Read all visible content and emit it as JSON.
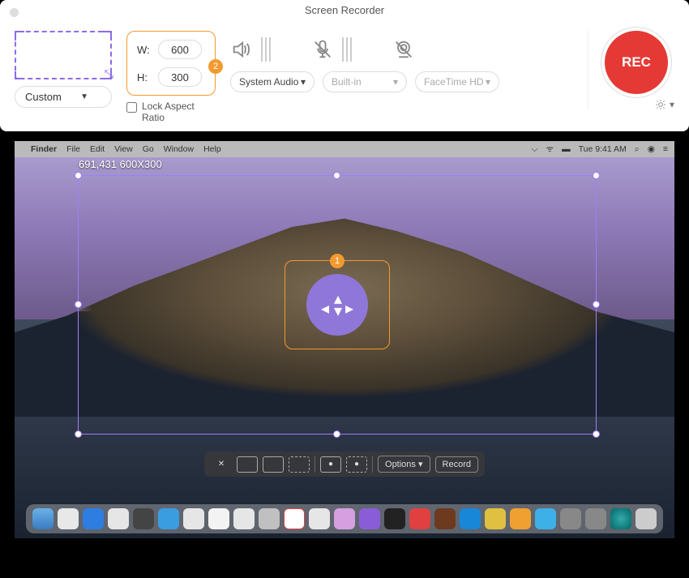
{
  "window": {
    "title": "Screen Recorder"
  },
  "region": {
    "preset": "Custom",
    "width": "600",
    "height": "300",
    "w_label": "W:",
    "h_label": "H:",
    "lock_label": "Lock Aspect Ratio",
    "badge": "2"
  },
  "audio": {
    "source": "System Audio",
    "mic": "Built-in",
    "camera": "FaceTime HD"
  },
  "record": {
    "label": "REC"
  },
  "selection": {
    "coords": "691,431",
    "size": "600X300",
    "move_badge": "1"
  },
  "menubar": {
    "apple": "",
    "app": "Finder",
    "items": [
      "File",
      "Edit",
      "View",
      "Go",
      "Window",
      "Help"
    ],
    "time": "Tue 9:41 AM"
  },
  "screenshot_toolbar": {
    "options": "Options",
    "record": "Record"
  }
}
